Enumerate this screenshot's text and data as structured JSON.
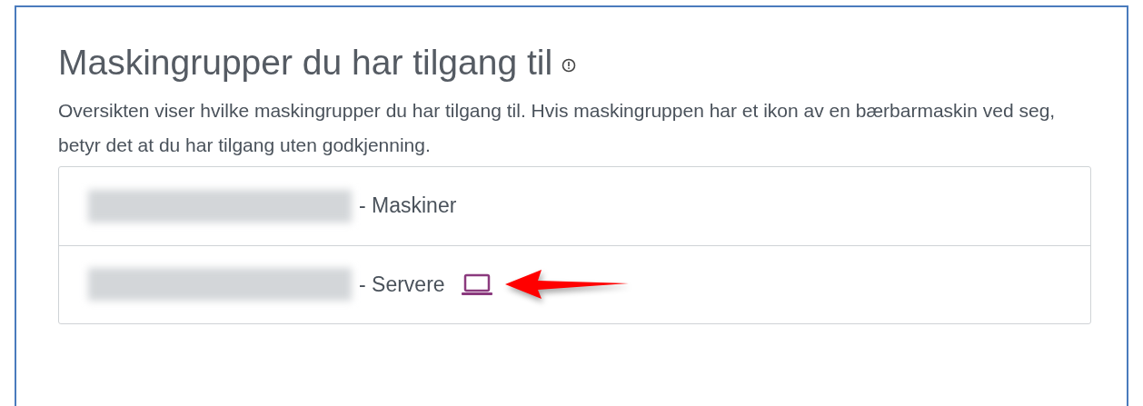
{
  "title": "Maskingrupper du har tilgang til",
  "description": "Oversikten viser hvilke maskingrupper du har tilgang til. Hvis maskingruppen har et ikon av en bærbarmaskin ved seg, betyr det at du har tilgang uten godkjenning.",
  "groups": [
    {
      "label": "- Maskiner",
      "laptop": false,
      "annotated": false
    },
    {
      "label": "- Servere",
      "laptop": true,
      "annotated": true
    }
  ]
}
